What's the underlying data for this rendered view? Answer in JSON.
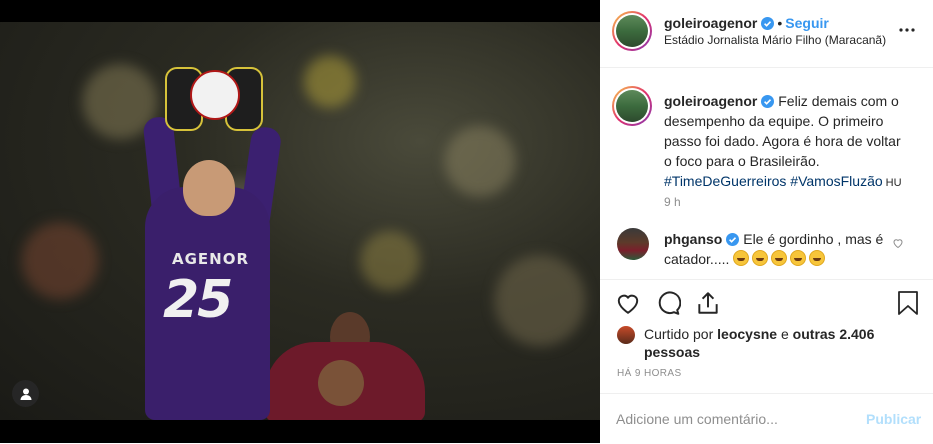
{
  "post": {
    "photo": {
      "jersey_name": "AGENOR",
      "jersey_number": "25"
    },
    "header": {
      "username": "goleiroagenor",
      "separator": "•",
      "follow_label": "Seguir",
      "location": "Estádio Jornalista Mário Filho (Maracanã)"
    },
    "caption": {
      "username": "goleiroagenor",
      "text": "Feliz demais com o desempenho da equipe. O primeiro passo foi dado. Agora é hora de voltar o foco para o Brasileirão.",
      "hashtags": [
        "#TimeDeGuerreiros",
        "#VamosFluzão"
      ],
      "tag": "HU",
      "time": "9 h"
    },
    "comments": [
      {
        "username": "phganso",
        "text": "Ele é gordinho , mas é catador.....",
        "emoji_count": 5
      }
    ],
    "likes": {
      "prefix": "Curtido por",
      "user": "leocysne",
      "middle": "e",
      "others": "outras 2.406 pessoas"
    },
    "timestamp": "HÁ 9 HORAS",
    "add_comment": {
      "placeholder": "Adicione um comentário...",
      "publish_label": "Publicar"
    }
  },
  "colors": {
    "accent": "#3897f0",
    "hashtag": "#003569",
    "muted": "#8e8e8e",
    "publish_disabled": "#b2dffc"
  }
}
